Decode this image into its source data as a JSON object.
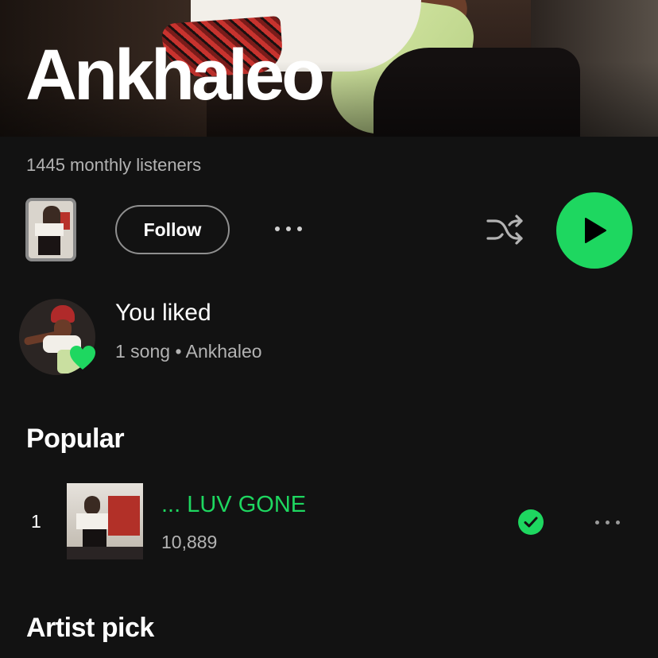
{
  "artist": {
    "name": "Ankhaleo",
    "monthly_listeners": "1445 monthly listeners"
  },
  "actions": {
    "follow_label": "Follow",
    "more_icon": "more-horizontal-icon",
    "shuffle_icon": "shuffle-icon",
    "play_icon": "play-icon"
  },
  "liked": {
    "title": "You liked",
    "subtitle": "1 song • Ankhaleo",
    "badge_icon": "heart-icon"
  },
  "popular": {
    "title": "Popular",
    "tracks": [
      {
        "rank": "1",
        "title": "... LUV GONE",
        "plays": "10,889",
        "saved": true,
        "status_icon": "check-circle-icon"
      }
    ]
  },
  "artist_pick": {
    "title": "Artist pick"
  },
  "colors": {
    "accent": "#1ed760",
    "background": "#121212",
    "secondary_text": "#b3b3b3"
  }
}
